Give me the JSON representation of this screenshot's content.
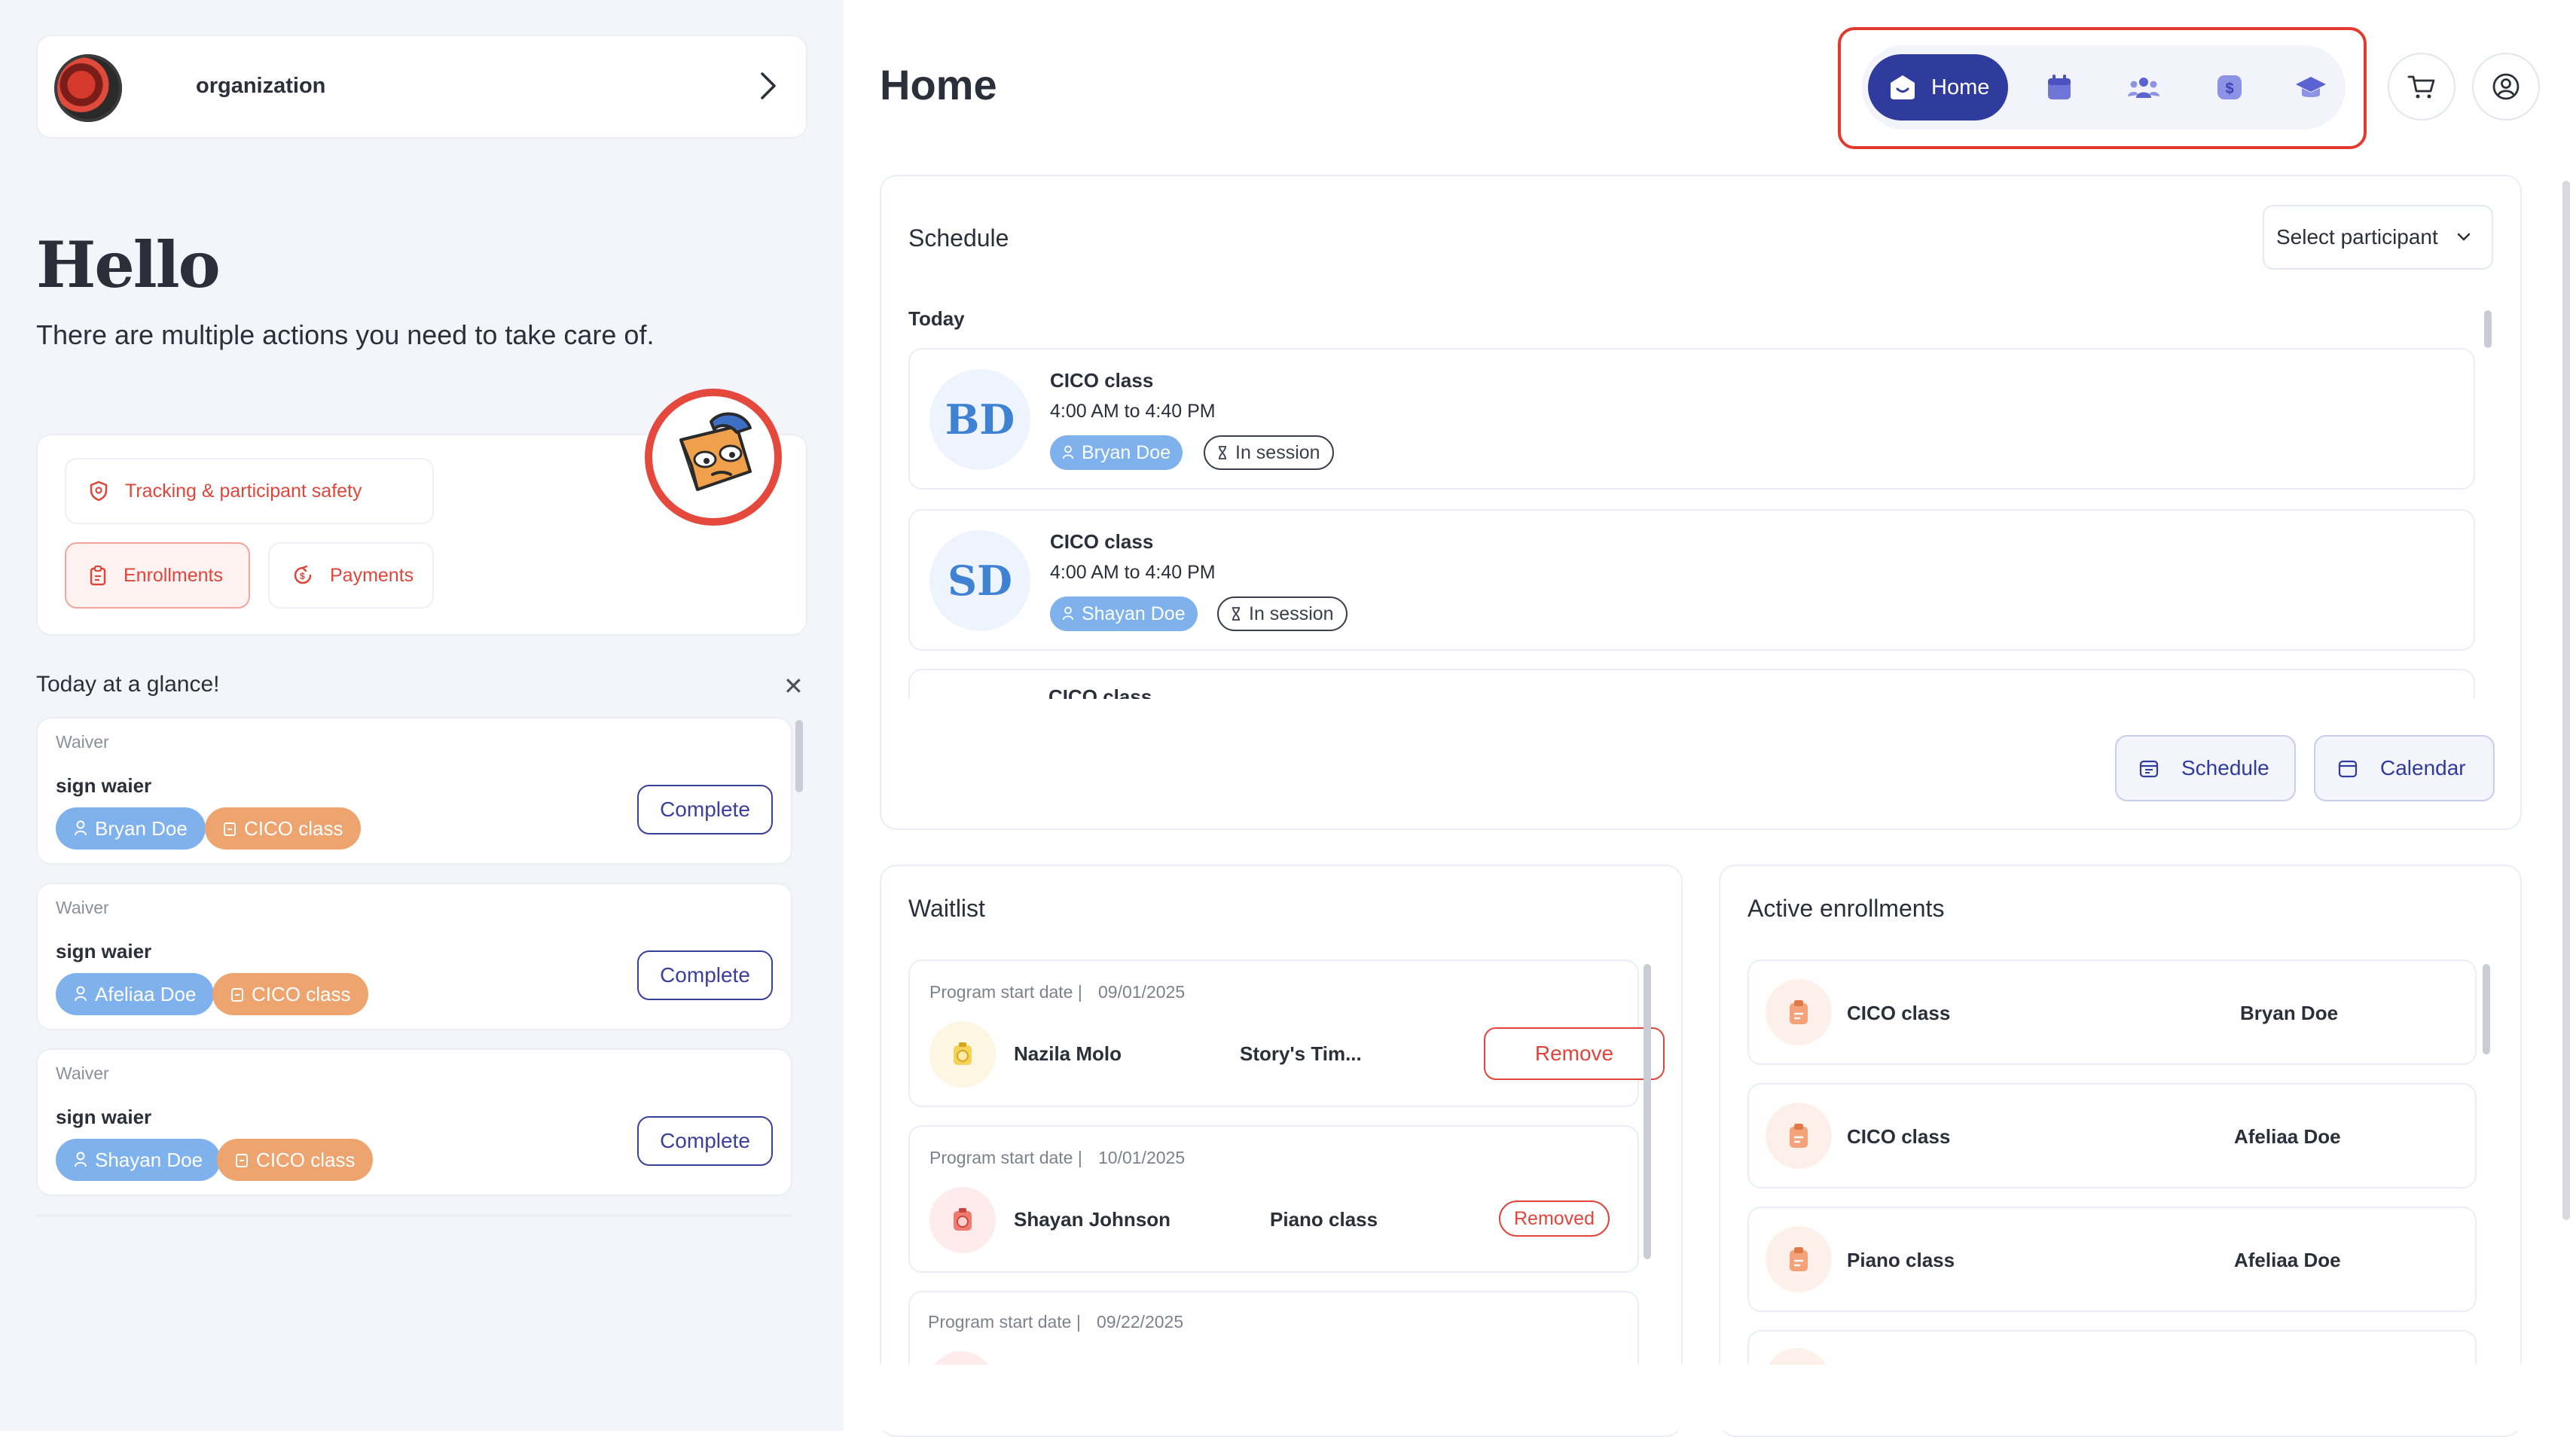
{
  "org": {
    "name": "organization"
  },
  "greeting": {
    "title": "Hello",
    "subtitle": "There are multiple actions you need to take care of."
  },
  "actions": {
    "tracking": "Tracking & participant safety",
    "enrollments": "Enrollments",
    "payments": "Payments"
  },
  "glance": {
    "title": "Today at a glance!",
    "tasks": [
      {
        "kind": "Waiver",
        "title": "sign waier",
        "person": "Bryan Doe",
        "program": "CICO class",
        "action": "Complete"
      },
      {
        "kind": "Waiver",
        "title": "sign waier",
        "person": "Afeliaa Doe",
        "program": "CICO class",
        "action": "Complete"
      },
      {
        "kind": "Waiver",
        "title": "sign waier",
        "person": "Shayan Doe",
        "program": "CICO class",
        "action": "Complete"
      }
    ]
  },
  "header": {
    "title": "Home",
    "nav_home": "Home"
  },
  "schedule": {
    "title": "Schedule",
    "select_placeholder": "Select participant",
    "today_label": "Today",
    "items": [
      {
        "initials": "BD",
        "title": "CICO class",
        "time": "4:00 AM to 4:40 PM",
        "person": "Bryan Doe",
        "status": "In session"
      },
      {
        "initials": "SD",
        "title": "CICO class",
        "time": "4:00 AM to 4:40 PM",
        "person": "Shayan Doe",
        "status": "In session"
      },
      {
        "title": "CICO class"
      }
    ],
    "schedule_button": "Schedule",
    "calendar_button": "Calendar"
  },
  "waitlist": {
    "title": "Waitlist",
    "start_label": "Program start date |",
    "items": [
      {
        "date": "09/01/2025",
        "name": "Nazila Molo",
        "program": "Story's Tim...",
        "action": "Remove"
      },
      {
        "date": "10/01/2025",
        "name": "Shayan Johnson",
        "program": "Piano class",
        "status": "Removed"
      },
      {
        "date": "09/22/2025"
      }
    ]
  },
  "enrollments": {
    "title": "Active enrollments",
    "items": [
      {
        "program": "CICO class",
        "person": "Bryan Doe"
      },
      {
        "program": "CICO class",
        "person": "Afeliaa Doe"
      },
      {
        "program": "Piano class",
        "person": "Afeliaa Doe"
      }
    ]
  },
  "colors": {
    "accent": "#2f3c9e",
    "danger": "#e0453b",
    "chip_blue": "#7fb2ec",
    "chip_orange": "#eea46f"
  }
}
